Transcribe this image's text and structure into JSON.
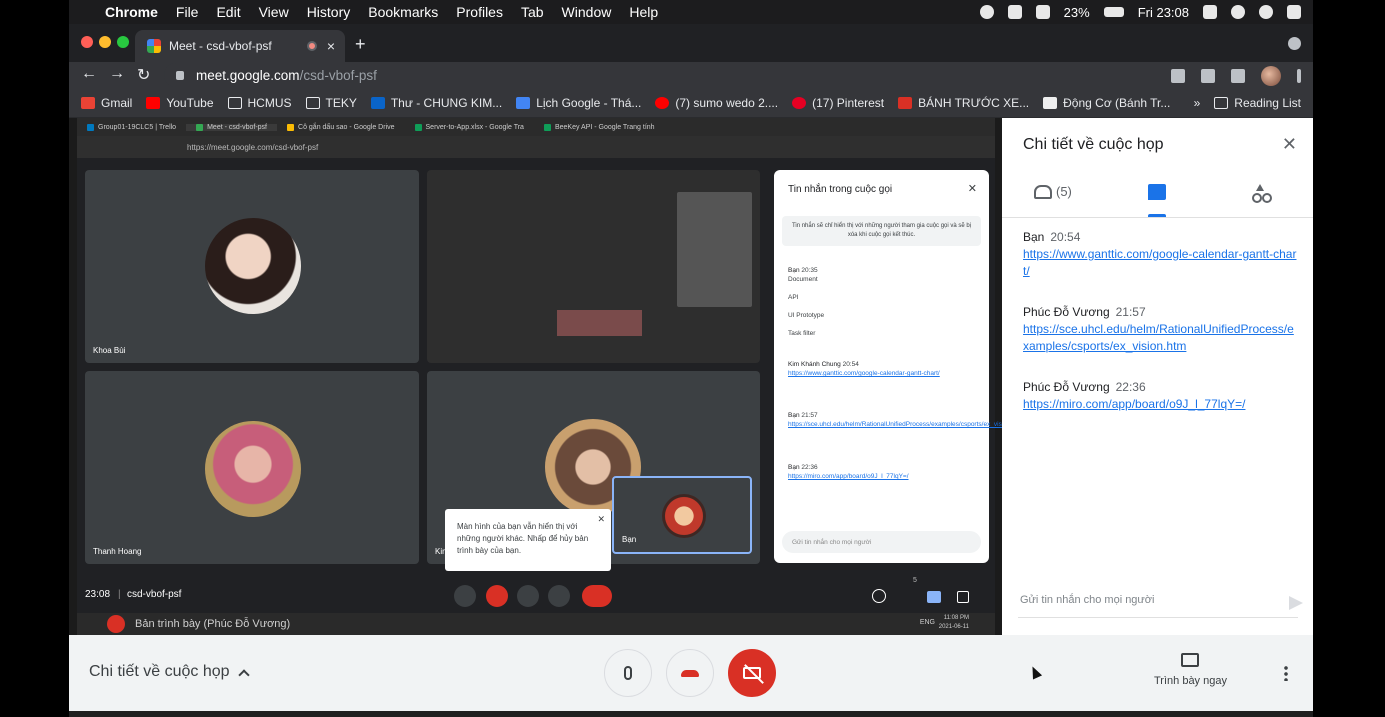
{
  "menubar": {
    "app": "Chrome",
    "items": [
      "File",
      "Edit",
      "View",
      "History",
      "Bookmarks",
      "Profiles",
      "Tab",
      "Window",
      "Help"
    ],
    "battery": "23%",
    "clock": "Fri 23:08"
  },
  "browser": {
    "tab_title": "Meet - csd-vbof-psf",
    "url_host": "meet.google.com",
    "url_path": "/csd-vbof-psf",
    "bookmarks": [
      "Gmail",
      "YouTube",
      "HCMUS",
      "TEKY",
      "Thư - CHUNG KIM...",
      "Lịch Google - Thá...",
      "(7) sumo wedo 2....",
      "(17) Pinterest",
      "BÁNH TRƯỚC XE...",
      "Động Cơ (Bánh Tr..."
    ],
    "bookmarks_more": "»",
    "reading_list": "Reading List"
  },
  "shared_screen": {
    "tabs": [
      "Group01-19CLC5 | Trello",
      "Meet - csd-vbof-psf",
      "Cô gắn dấu sao - Google Drive",
      "Server-to-App.xlsx - Google Tra",
      "BeeKey API - Google Trang tính"
    ],
    "url": "https://meet.google.com/csd-vbof-psf",
    "tiles": [
      "Khoa Bùi",
      "Thanh Hoang",
      "Kim",
      "Bạn"
    ],
    "panel_title": "Tin nhắn trong cuộc gọi",
    "panel_notice": "Tin nhắn sẽ chỉ hiển thị với những người tham gia cuộc gọi và sẽ bị xóa khi cuộc gọi kết thúc.",
    "msgs": [
      {
        "sender": "Bạn",
        "time": "20:35",
        "lines": [
          "Document",
          "API",
          "UI Prototype",
          "Task filter"
        ]
      },
      {
        "sender": "Kim Khánh Chung",
        "time": "20:54",
        "link": "https://www.ganttic.com/google-calendar-gantt-chart/"
      },
      {
        "sender": "Bạn",
        "time": "21:57",
        "link": "https://sce.uhcl.edu/helm/RationalUnifiedProcess/examples/csports/ex_vision.htm"
      },
      {
        "sender": "Bạn",
        "time": "22:36",
        "link": "https://miro.com/app/board/o9J_l_77lqY=/"
      }
    ],
    "panel_input": "Gửi tin nhắn cho mọi người",
    "toast": "Màn hình của bạn vẫn hiển thị với những người khác. Nhấp để hủy bản trình bày của bạn.",
    "bottom_time": "23:08",
    "bottom_code": "csd-vbof-psf",
    "participant_count": "5",
    "taskbar_text": "Bản trình bày (Phúc Đỗ Vương)",
    "taskbar_lang": "ENG",
    "taskbar_time": "11:08 PM",
    "taskbar_date": "2021-06-11"
  },
  "details": {
    "title": "Chi tiết về cuộc họp",
    "people_count": "(5)",
    "messages": [
      {
        "sender": "Bạn",
        "time": "20:54",
        "link": "https://www.ganttic.com/google-calendar-gantt-chart/"
      },
      {
        "sender": "Phúc Đỗ Vương",
        "time": "21:57",
        "link": "https://sce.uhcl.edu/helm/RationalUnifiedProcess/examples/csports/ex_vision.htm"
      },
      {
        "sender": "Phúc Đỗ Vương",
        "time": "22:36",
        "link": "https://miro.com/app/board/o9J_l_77lqY=/"
      }
    ],
    "input_placeholder": "Gửi tin nhắn cho mọi người"
  },
  "meetbar": {
    "title": "Chi tiết về cuộc họp",
    "present_label": "Trình bày ngay"
  },
  "colors": {
    "accent": "#1a73e8",
    "danger": "#d93025",
    "panel_bg": "#ffffff",
    "bar_bg": "#f1f3f4"
  }
}
